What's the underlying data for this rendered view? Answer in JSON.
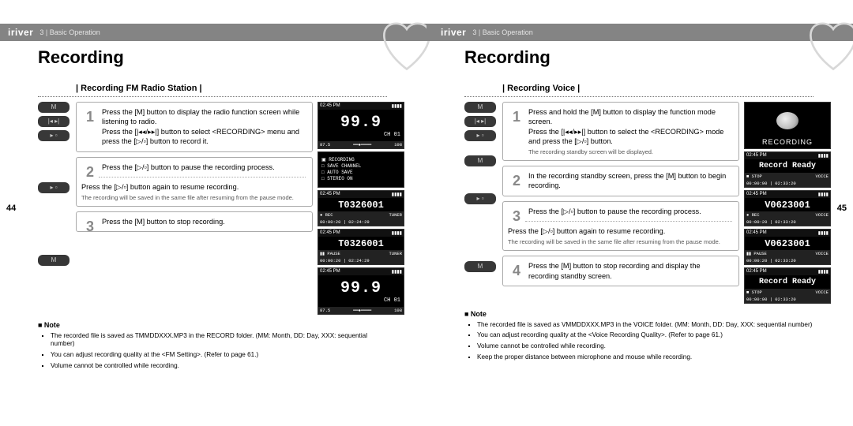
{
  "brand": "iriver",
  "crumb": "3 | Basic Operation",
  "left": {
    "page_num": "44",
    "title": "Recording",
    "section": "| Recording FM Radio Station |",
    "steps": {
      "s1a": "Press the [M] button to display the radio function screen while listening to radio.",
      "s1b": "Press the [|◂◂/▸▸|] button to select <RECORDING> menu and press the [▷/▫] button to record it.",
      "s2a": "Press the [▷/▫] button to pause the recording process.",
      "s2b": "Press the [▷/▫] button again to resume recording.",
      "s2sub": "The recording will be saved in the same file after resuming from the pause mode.",
      "s3a": "Press the [M] button to stop recording."
    },
    "note": {
      "head": "■ Note",
      "n1": "The recorded file is saved as TMMDDXXX.MP3 in the RECORD folder. (MM: Month, DD: Day, XXX: sequential number)",
      "n2": "You can adjust recording quality at the <FM Setting>. (Refer to page 61.)",
      "n3": "Volume cannot be controlled while recording."
    },
    "lcd": {
      "clock": "02:45 PM",
      "batt": "▮▮▮▮",
      "freq": "99.9",
      "ch": "CH 01",
      "band_lo": "87.5",
      "band_hi": "108",
      "menu1": "▣ RECORDING",
      "menu2": "□ SAVE CHANNEL",
      "menu3": "□ AUTO SAVE",
      "menu4": "□ STEREO ON",
      "file": "T0326001",
      "rec": "● REC",
      "pause": "▮▮ PAUSE",
      "tuner": "TUNER",
      "time1": "00:00:20 | 02:24:29",
      "time2": "00:00:20 | 02:24:29"
    }
  },
  "right": {
    "page_num": "45",
    "title": "Recording",
    "section": "| Recording Voice |",
    "steps": {
      "s1a": "Press and hold the [M] button to display the function mode screen.",
      "s1b": "Press the [|◂◂/▸▸|] button to select the <RECORDING> mode and press the [▷/▫] button.",
      "s1sub": "The recording standby screen will be displayed.",
      "s2a": "In the recording standby screen, press the [M] button to begin recording.",
      "s3a": "Press the [▷/▫] button to pause the recording process.",
      "s3b": "Press the [▷/▫] button again to resume recording.",
      "s3sub": "The recording will be saved in the same file after resuming from the pause mode.",
      "s4a": "Press the [M] button to stop recording and display the recording standby screen."
    },
    "note": {
      "head": "■ Note",
      "n1": "The recorded file is saved as VMMDDXXX.MP3 in the VOICE folder. (MM: Month, DD: Day, XXX: sequential number)",
      "n2": "You can adjust recording quality at the <Voice Recording Quality>. (Refer to page 61.)",
      "n3": "Volume cannot be controlled while recording.",
      "n4": "Keep the proper distance between microphone and mouse while recording."
    },
    "lcd": {
      "clock": "02:45 PM",
      "batt": "▮▮▮▮",
      "recording": "RECORDING",
      "ready": "Record Ready",
      "stop": "■ STOP",
      "voice": "VOICE",
      "time0": "00:00:00 | 02:33:20",
      "file": "V0623001",
      "rec": "● REC",
      "pause": "▮▮ PAUSE",
      "time1": "00:00:20 | 02:33:20"
    }
  }
}
